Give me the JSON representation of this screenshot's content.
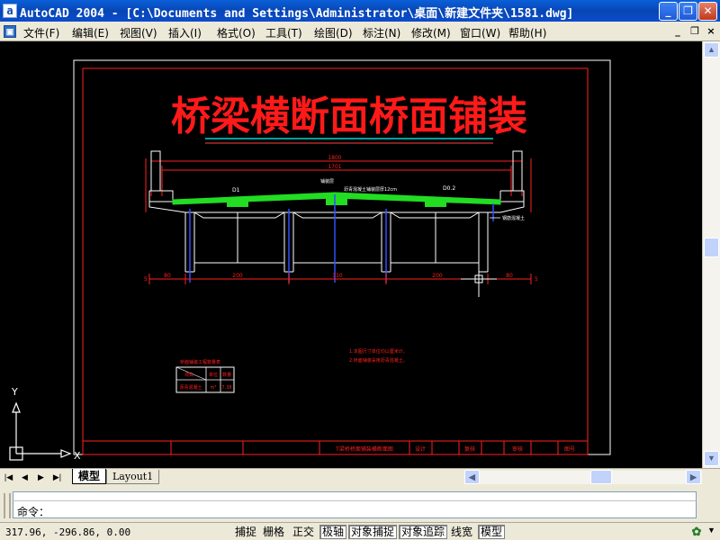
{
  "titlebar": {
    "app_icon": "a",
    "title": "AutoCAD 2004 - [C:\\Documents and Settings\\Administrator\\桌面\\新建文件夹\\1581.dwg]",
    "buttons": {
      "minimize": "minimize-icon",
      "restore": "restore-icon",
      "close": "close-icon"
    }
  },
  "menubar": {
    "items": [
      {
        "label": "文件(F)"
      },
      {
        "label": "编辑(E)"
      },
      {
        "label": "视图(V)"
      },
      {
        "label": "插入(I)"
      },
      {
        "label": "格式(O)"
      },
      {
        "label": "工具(T)"
      },
      {
        "label": "绘图(D)"
      },
      {
        "label": "标注(N)"
      },
      {
        "label": "修改(M)"
      },
      {
        "label": "窗口(W)"
      },
      {
        "label": "帮助(H)"
      }
    ],
    "mdi_buttons": {
      "minimize": "_",
      "restore": "❐",
      "close": "×"
    }
  },
  "drawing": {
    "title": "桥梁横断面桥面铺装",
    "colors": {
      "background": "#000000",
      "frame": "#ffffff",
      "title": "#ff1a1a",
      "underline": "#00ffff",
      "structure": "#ffffff",
      "paving": "#22dd22",
      "dimension": "#ff2020",
      "piles": "#3050ff"
    },
    "labels": {
      "d1": "D1",
      "d02": "D0.2",
      "total_width": "1800",
      "deck_width": "1701",
      "paving_note": "沥青混凝土铺装层厚12cm",
      "paving_label": "铺装层",
      "span_left_end": "80",
      "span_1": "200",
      "span_2": "310",
      "span_3": "200",
      "span_right_end": "80",
      "side_mark_left": "5",
      "side_mark_right": "5",
      "right_callout": "钢筋混凝土"
    },
    "notes": [
      "1.本图尺寸单位均以厘米计。",
      "2.桥面铺装采用沥青混凝土。"
    ],
    "table": {
      "title": "桥面铺装工程数量表",
      "headers": [
        "项目",
        "单位",
        "数量"
      ],
      "row": [
        "沥青混凝土",
        "m³",
        "7.38"
      ]
    },
    "titleblock": {
      "drawing_name": "T梁桥桥面铺装横断面图",
      "cells": [
        "设计",
        "复核",
        "审核",
        "图号"
      ]
    },
    "ucs": {
      "y": "Y",
      "x": "X"
    }
  },
  "tabs": {
    "nav": [
      "|◀",
      "◀",
      "▶",
      "▶|"
    ],
    "model": "模型",
    "layout1": "Layout1"
  },
  "command": {
    "prompt": "命令："
  },
  "status": {
    "coords": "317.96, -296.86, 0.00",
    "toggles": [
      {
        "label": "捕捉",
        "on": false
      },
      {
        "label": "栅格",
        "on": false
      },
      {
        "label": "正交",
        "on": false
      },
      {
        "label": "极轴",
        "on": true
      },
      {
        "label": "对象捕捉",
        "on": true
      },
      {
        "label": "对象追踪",
        "on": true
      },
      {
        "label": "线宽",
        "on": false
      },
      {
        "label": "模型",
        "on": true
      }
    ],
    "tray_icon": "tray-icon"
  }
}
